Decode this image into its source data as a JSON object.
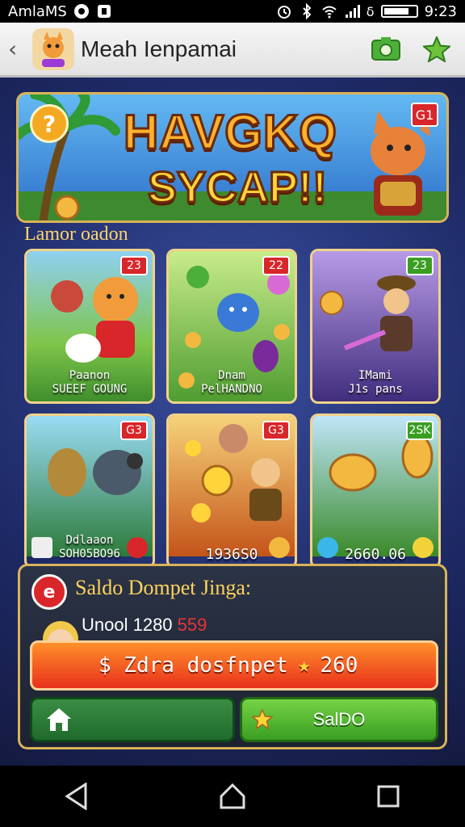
{
  "status_bar": {
    "left_text": "AmlaMS",
    "time": "9:23"
  },
  "app_bar": {
    "title": "Meah Ienpamai"
  },
  "banner": {
    "title_line1": "HAVGKQ",
    "title_line2": "SYCAP!!",
    "badge": "G1"
  },
  "section_label": "Lamor oadon",
  "cards": [
    {
      "badge": "23",
      "caption1": "Paanon",
      "caption2": "SUEEF GOUNG",
      "colors": [
        "#7ec54a",
        "#3a8a2a"
      ]
    },
    {
      "badge": "22",
      "caption1": "Dnam",
      "caption2": "PelHANDNO",
      "colors": [
        "#a6d65a",
        "#4c9a2e"
      ]
    },
    {
      "badge": "23",
      "caption1": "IMami",
      "caption2": "J1s pans",
      "colors": [
        "#8a6ad6",
        "#3c2a7a"
      ]
    },
    {
      "badge": "G3",
      "caption1": "Ddlaaon",
      "caption2": "SOH05BO96",
      "colors": [
        "#8ad0f0",
        "#2d7a3a"
      ]
    },
    {
      "badge": "G3",
      "caption1": "",
      "caption2": "1936S0",
      "colors": [
        "#f2b840",
        "#c4541a"
      ]
    },
    {
      "badge": "2SK",
      "caption1": "",
      "caption2": "2660.06",
      "colors": [
        "#7ac8f2",
        "#3a8a2a"
      ]
    }
  ],
  "wallet": {
    "title": "Saldo Dompet Jinga:",
    "line_prefix": "Unool 1280",
    "line_highlight": "559",
    "bar_text": "$ Zdra dosfnpet",
    "bar_value": "260",
    "saldo_button": "SalDO"
  },
  "colors": {
    "accent": "#ffd45a",
    "danger": "#d8262a",
    "success": "#3a9e22"
  }
}
